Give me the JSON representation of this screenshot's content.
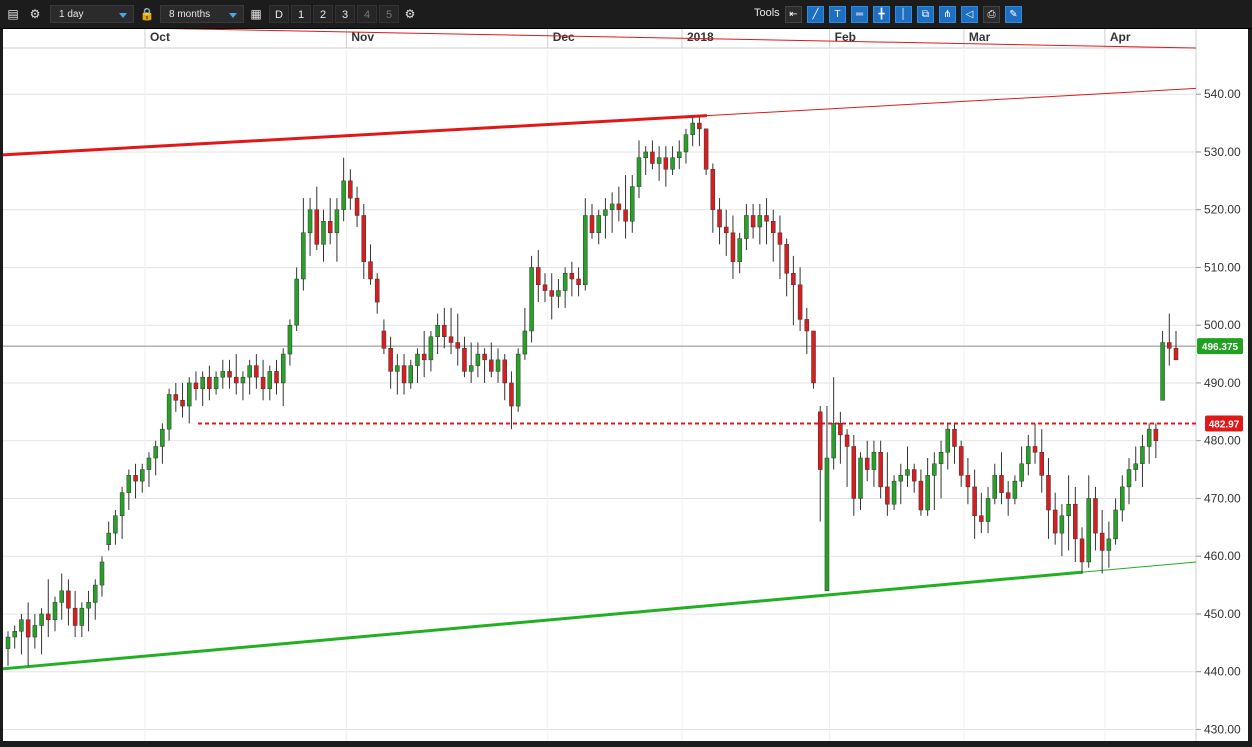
{
  "toolbar": {
    "interval": "1 day",
    "range": "8 months",
    "buttons": [
      "D",
      "1",
      "2",
      "3",
      "4",
      "5"
    ],
    "tools_label": "Tools",
    "colors": {
      "background": "#1c1c1c",
      "accent": "#4aa7e6",
      "active_tool": "#1e6fbf"
    }
  },
  "chart_data": {
    "type": "candlestick",
    "title": "",
    "xlabel": "",
    "ylabel": "",
    "ylim": [
      428,
      548
    ],
    "y_ticks": [
      430,
      440,
      450,
      460,
      470,
      480,
      490,
      500,
      510,
      520,
      530,
      540
    ],
    "y_tick_labels": [
      "430.00",
      "440.00",
      "450.00",
      "460.00",
      "470.00",
      "480.00",
      "490.00",
      "500.00",
      "510.00",
      "520.00",
      "530.00",
      "540.00"
    ],
    "x_labels": [
      "Oct",
      "Nov",
      "Dec",
      "2018",
      "Feb",
      "Mar",
      "Apr"
    ],
    "grid": true,
    "colors": {
      "up": "#27a127",
      "down": "#d81e1e",
      "wick": "#333333"
    },
    "current_price": {
      "value": 496.375,
      "label": "496.375",
      "color": "#21a021"
    },
    "support_level": {
      "value": 482.97,
      "label": "482.97",
      "color": "#e01818",
      "style": "dashed"
    },
    "trendlines": [
      {
        "name": "upper",
        "color": "#e01818",
        "from": 529.5,
        "to": 541.0
      },
      {
        "name": "lower",
        "color": "#22b022",
        "from": 440.5,
        "to": 459.0
      }
    ],
    "candles": [
      [
        444,
        447,
        441,
        446
      ],
      [
        446,
        448,
        444,
        447
      ],
      [
        447,
        450,
        443,
        449
      ],
      [
        449,
        452,
        441,
        446
      ],
      [
        446,
        450,
        444,
        448
      ],
      [
        448,
        451,
        443,
        450
      ],
      [
        450,
        456,
        446,
        449
      ],
      [
        449,
        453,
        447,
        452
      ],
      [
        452,
        457,
        449,
        454
      ],
      [
        454,
        456,
        448,
        451
      ],
      [
        451,
        454,
        446,
        448
      ],
      [
        448,
        452,
        446,
        451
      ],
      [
        451,
        454,
        447,
        452
      ],
      [
        452,
        456,
        449,
        455
      ],
      [
        455,
        460,
        453,
        459
      ],
      [
        462,
        466,
        461,
        464
      ],
      [
        464,
        468,
        462,
        467
      ],
      [
        467,
        472,
        463,
        471
      ],
      [
        471,
        475,
        468,
        474
      ],
      [
        474,
        476,
        470,
        473
      ],
      [
        473,
        476,
        471,
        475
      ],
      [
        475,
        478,
        472,
        477
      ],
      [
        477,
        480,
        474,
        479
      ],
      [
        479,
        483,
        476,
        482
      ],
      [
        482,
        489,
        480,
        488
      ],
      [
        488,
        490,
        485,
        487
      ],
      [
        487,
        490,
        484,
        486
      ],
      [
        486,
        491,
        483,
        490
      ],
      [
        490,
        492,
        487,
        489
      ],
      [
        489,
        492,
        486,
        491
      ],
      [
        491,
        493,
        487,
        489
      ],
      [
        489,
        492,
        488,
        491
      ],
      [
        491,
        494,
        489,
        492
      ],
      [
        492,
        494,
        489,
        491
      ],
      [
        491,
        495,
        488,
        490
      ],
      [
        490,
        492,
        487,
        491
      ],
      [
        491,
        494,
        488,
        493
      ],
      [
        493,
        495,
        489,
        491
      ],
      [
        491,
        494,
        487,
        489
      ],
      [
        489,
        493,
        487,
        492
      ],
      [
        492,
        494,
        488,
        490
      ],
      [
        490,
        496,
        486,
        495
      ],
      [
        495,
        501,
        493,
        500
      ],
      [
        500,
        510,
        499,
        508
      ],
      [
        508,
        522,
        506,
        516
      ],
      [
        516,
        522,
        512,
        520
      ],
      [
        520,
        524,
        513,
        514
      ],
      [
        514,
        520,
        511,
        518
      ],
      [
        518,
        522,
        514,
        516
      ],
      [
        516,
        522,
        511,
        520
      ],
      [
        520,
        529,
        518,
        525
      ],
      [
        525,
        527,
        520,
        522
      ],
      [
        522,
        524,
        517,
        519
      ],
      [
        519,
        521,
        508,
        511
      ],
      [
        511,
        514,
        507,
        508
      ],
      [
        508,
        509,
        502,
        504
      ],
      [
        499,
        501,
        495,
        496
      ],
      [
        496,
        498,
        489,
        492
      ],
      [
        492,
        495,
        488,
        493
      ],
      [
        493,
        495,
        488,
        490
      ],
      [
        490,
        494,
        489,
        493
      ],
      [
        493,
        496,
        490,
        495
      ],
      [
        495,
        499,
        491,
        494
      ],
      [
        494,
        499,
        492,
        498
      ],
      [
        498,
        502,
        495,
        500
      ],
      [
        500,
        503,
        496,
        498
      ],
      [
        498,
        503,
        495,
        497
      ],
      [
        497,
        502,
        493,
        496
      ],
      [
        496,
        498,
        491,
        492
      ],
      [
        492,
        497,
        490,
        493
      ],
      [
        493,
        497,
        491,
        495
      ],
      [
        495,
        496,
        490,
        494
      ],
      [
        494,
        497,
        491,
        492
      ],
      [
        492,
        496,
        490,
        494
      ],
      [
        494,
        495,
        487,
        490
      ],
      [
        490,
        492,
        482,
        486
      ],
      [
        486,
        496,
        485,
        495
      ],
      [
        495,
        503,
        494,
        499
      ],
      [
        499,
        512,
        497,
        510
      ],
      [
        510,
        513,
        504,
        507
      ],
      [
        507,
        509,
        504,
        506
      ],
      [
        506,
        509,
        501,
        505
      ],
      [
        505,
        508,
        503,
        506
      ],
      [
        506,
        510,
        503,
        509
      ],
      [
        509,
        511,
        505,
        508
      ],
      [
        508,
        510,
        505,
        507
      ],
      [
        507,
        522,
        506,
        519
      ],
      [
        519,
        521,
        515,
        516
      ],
      [
        516,
        520,
        514,
        519
      ],
      [
        519,
        522,
        515,
        520
      ],
      [
        520,
        523,
        516,
        521
      ],
      [
        521,
        524,
        518,
        520
      ],
      [
        520,
        526,
        515,
        518
      ],
      [
        518,
        526,
        516,
        524
      ],
      [
        524,
        532,
        522,
        529
      ],
      [
        529,
        531,
        526,
        530
      ],
      [
        530,
        532,
        527,
        528
      ],
      [
        528,
        531,
        525,
        529
      ],
      [
        529,
        531,
        524,
        527
      ],
      [
        527,
        531,
        526,
        529
      ],
      [
        529,
        532,
        527,
        530
      ],
      [
        530,
        534,
        528,
        533
      ],
      [
        533,
        536,
        531,
        535
      ],
      [
        535,
        536,
        531,
        534
      ],
      [
        534,
        528,
        526,
        527
      ],
      [
        527,
        528,
        516,
        520
      ],
      [
        520,
        522,
        514,
        517
      ],
      [
        517,
        520,
        512,
        516
      ],
      [
        516,
        519,
        508,
        511
      ],
      [
        511,
        516,
        509,
        515
      ],
      [
        515,
        521,
        513,
        519
      ],
      [
        519,
        521,
        515,
        517
      ],
      [
        517,
        521,
        514,
        519
      ],
      [
        519,
        522,
        514,
        518
      ],
      [
        518,
        520,
        511,
        516
      ],
      [
        516,
        519,
        508,
        514
      ],
      [
        514,
        515,
        505,
        509
      ],
      [
        509,
        512,
        500,
        507
      ],
      [
        507,
        510,
        499,
        501
      ],
      [
        501,
        503,
        495,
        499
      ],
      [
        499,
        491,
        489,
        490
      ],
      [
        485,
        486,
        466,
        475
      ],
      [
        454,
        486,
        454,
        477
      ],
      [
        477,
        491,
        475,
        483
      ],
      [
        483,
        485,
        476,
        481
      ],
      [
        481,
        482,
        472,
        479
      ],
      [
        479,
        481,
        467,
        470
      ],
      [
        470,
        478,
        468,
        477
      ],
      [
        477,
        480,
        473,
        475
      ],
      [
        475,
        480,
        472,
        478
      ],
      [
        478,
        480,
        470,
        472
      ],
      [
        472,
        478,
        467,
        469
      ],
      [
        469,
        474,
        468,
        473
      ],
      [
        473,
        476,
        469,
        474
      ],
      [
        474,
        479,
        472,
        475
      ],
      [
        475,
        476,
        471,
        473
      ],
      [
        473,
        475,
        467,
        468
      ],
      [
        468,
        477,
        467,
        474
      ],
      [
        474,
        478,
        468,
        476
      ],
      [
        476,
        480,
        470,
        478
      ],
      [
        478,
        483,
        475,
        482
      ],
      [
        482,
        483,
        476,
        479
      ],
      [
        479,
        480,
        472,
        474
      ],
      [
        474,
        477,
        469,
        472
      ],
      [
        472,
        475,
        463,
        467
      ],
      [
        467,
        471,
        464,
        466
      ],
      [
        466,
        472,
        464,
        470
      ],
      [
        470,
        476,
        469,
        474
      ],
      [
        474,
        478,
        469,
        471
      ],
      [
        471,
        473,
        467,
        470
      ],
      [
        470,
        474,
        469,
        473
      ],
      [
        473,
        479,
        472,
        476
      ],
      [
        476,
        481,
        474,
        479
      ],
      [
        479,
        483,
        476,
        478
      ],
      [
        478,
        482,
        471,
        474
      ],
      [
        474,
        477,
        463,
        468
      ],
      [
        468,
        471,
        462,
        464
      ],
      [
        464,
        469,
        460,
        467
      ],
      [
        467,
        474,
        461,
        469
      ],
      [
        469,
        472,
        459,
        463
      ],
      [
        463,
        465,
        457,
        459
      ],
      [
        459,
        474,
        458,
        470
      ],
      [
        470,
        472,
        461,
        464
      ],
      [
        464,
        468,
        457,
        461
      ],
      [
        461,
        466,
        458,
        463
      ],
      [
        463,
        470,
        462,
        468
      ],
      [
        468,
        474,
        466,
        472
      ],
      [
        472,
        477,
        469,
        475
      ],
      [
        475,
        479,
        473,
        476
      ],
      [
        476,
        481,
        472,
        479
      ],
      [
        479,
        483,
        476,
        482
      ],
      [
        482,
        483,
        477,
        480
      ],
      [
        487,
        499,
        487,
        497
      ],
      [
        497,
        502,
        493,
        496
      ],
      [
        496,
        499,
        494,
        494
      ]
    ],
    "interactive_overlay": true
  }
}
